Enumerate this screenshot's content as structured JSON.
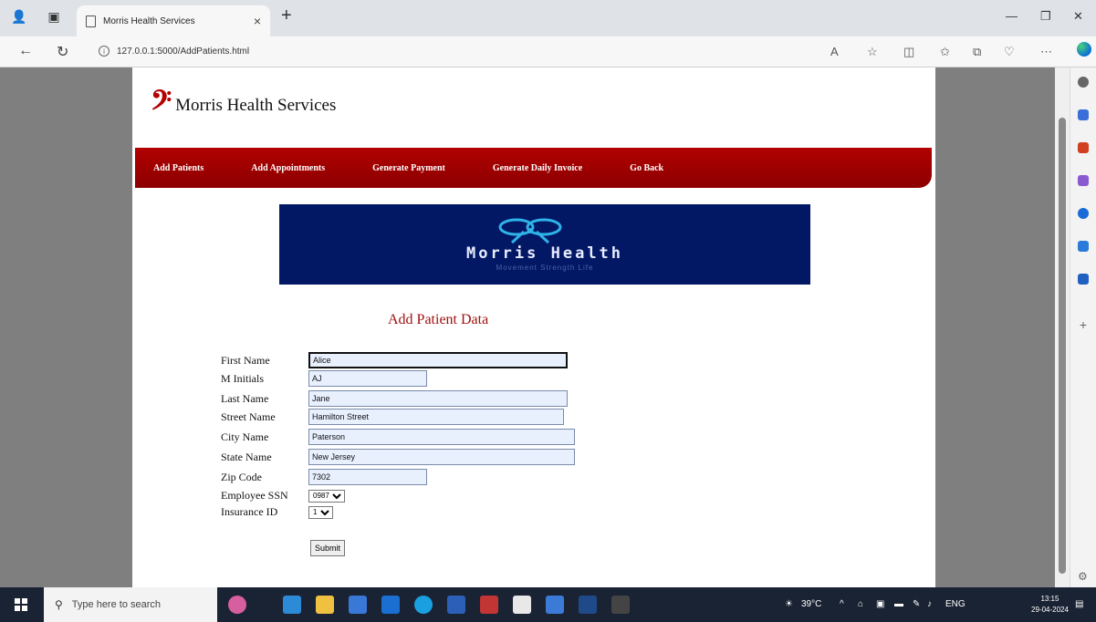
{
  "browser": {
    "tab_title": "Morris Health Services",
    "tab_close": "×",
    "new_tab": "+",
    "url": "127.0.0.1:5000/AddPatients.html"
  },
  "site": {
    "brand_name": "Morris Health Services",
    "brand_mark": "𝄢",
    "nav": [
      "Add Patients",
      "Add Appointments",
      "Generate Payment",
      "Generate Daily Invoice",
      "Go Back"
    ]
  },
  "banner": {
    "text": "Morris Health",
    "tagline": "Movement Strength Life"
  },
  "form": {
    "title": "Add Patient Data",
    "fields": [
      {
        "label": "First Name",
        "value": "Alice"
      },
      {
        "label": "M Initials",
        "value": "AJ"
      },
      {
        "label": "Last Name",
        "value": "Jane"
      },
      {
        "label": "Street Name",
        "value": "Hamilton Street"
      },
      {
        "label": "City Name",
        "value": "Paterson"
      },
      {
        "label": "State Name",
        "value": "New Jersey"
      },
      {
        "label": "Zip Code",
        "value": "7302"
      }
    ],
    "employee_ssn_label": "Employee SSN",
    "employee_ssn_value": "0987",
    "insurance_id_label": "Insurance ID",
    "insurance_id_value": "1",
    "submit_label": "Submit"
  },
  "taskbar": {
    "search_placeholder": "Type here to search",
    "weather": "39°C",
    "language": "ENG",
    "time": "13:15",
    "date": "29-04-2024"
  },
  "colors": {
    "menubar": "#a00000",
    "banner_bg": "#021865",
    "title": "#a01010"
  }
}
